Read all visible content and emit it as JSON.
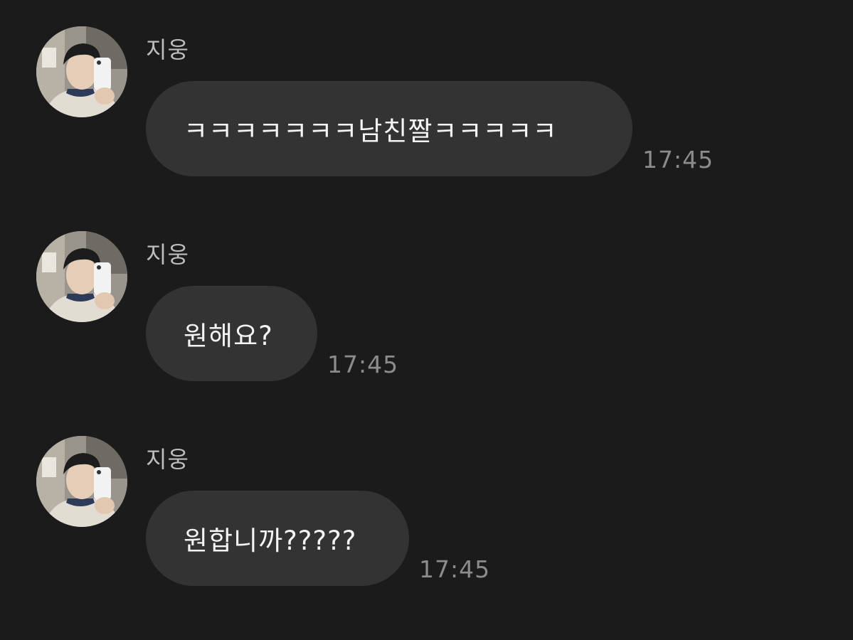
{
  "messages": [
    {
      "sender": "지웅",
      "text": "ㅋㅋㅋㅋㅋㅋㅋ남친짤ㅋㅋㅋㅋㅋ",
      "time": "17:45"
    },
    {
      "sender": "지웅",
      "text": "원해요?",
      "time": "17:45"
    },
    {
      "sender": "지웅",
      "text": "원합니까?????",
      "time": "17:45"
    }
  ],
  "colors": {
    "background": "#1b1b1b",
    "bubble": "#333333",
    "sender_text": "#bdbdbd",
    "time_text": "#8c8c8c"
  },
  "icons": {
    "avatar": "profile-photo-avatar"
  }
}
